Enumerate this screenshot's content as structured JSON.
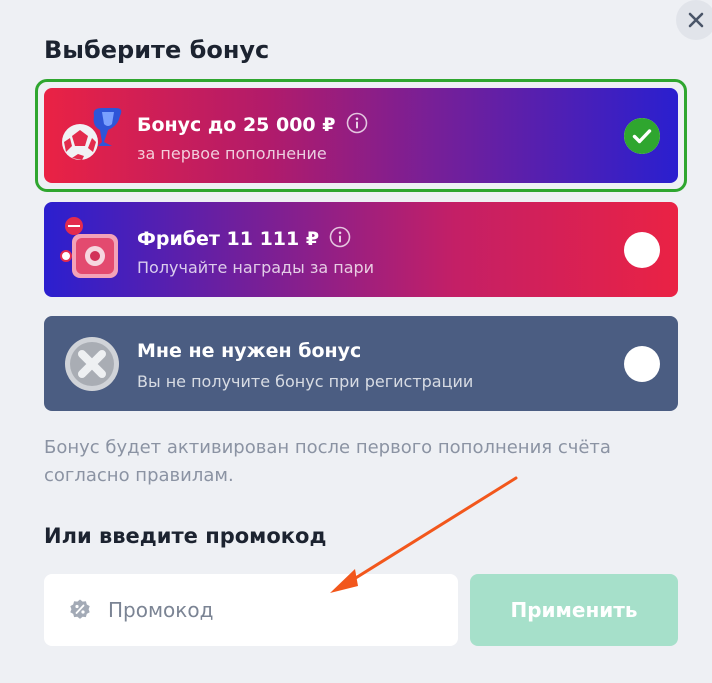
{
  "modal": {
    "title": "Выберите бонус",
    "close_icon": "close-icon"
  },
  "bonuses": [
    {
      "title": "Бонус до 25 000 ₽",
      "subtitle": "за первое пополнение",
      "icon": "soccer-trophy-icon",
      "has_info": true,
      "selected": true
    },
    {
      "title": "Фрибет 11 111 ₽",
      "subtitle": "Получайте награды за пари",
      "icon": "gift-safe-icon",
      "has_info": true,
      "selected": false
    },
    {
      "title": "Мне не нужен бонус",
      "subtitle": "Вы не получите бонус при регистрации",
      "icon": "no-bonus-x-icon",
      "has_info": false,
      "selected": false
    }
  ],
  "note": "Бонус будет активирован после первого пополнения счёта согласно правилам.",
  "promo": {
    "heading": "Или введите промокод",
    "placeholder": "Промокод",
    "value": "",
    "apply_label": "Применить"
  },
  "colors": {
    "selected_border": "#2fa62f",
    "check": "#2fa62f",
    "apply_disabled": "#a6e0ca",
    "annotation_arrow": "#f2571c"
  }
}
